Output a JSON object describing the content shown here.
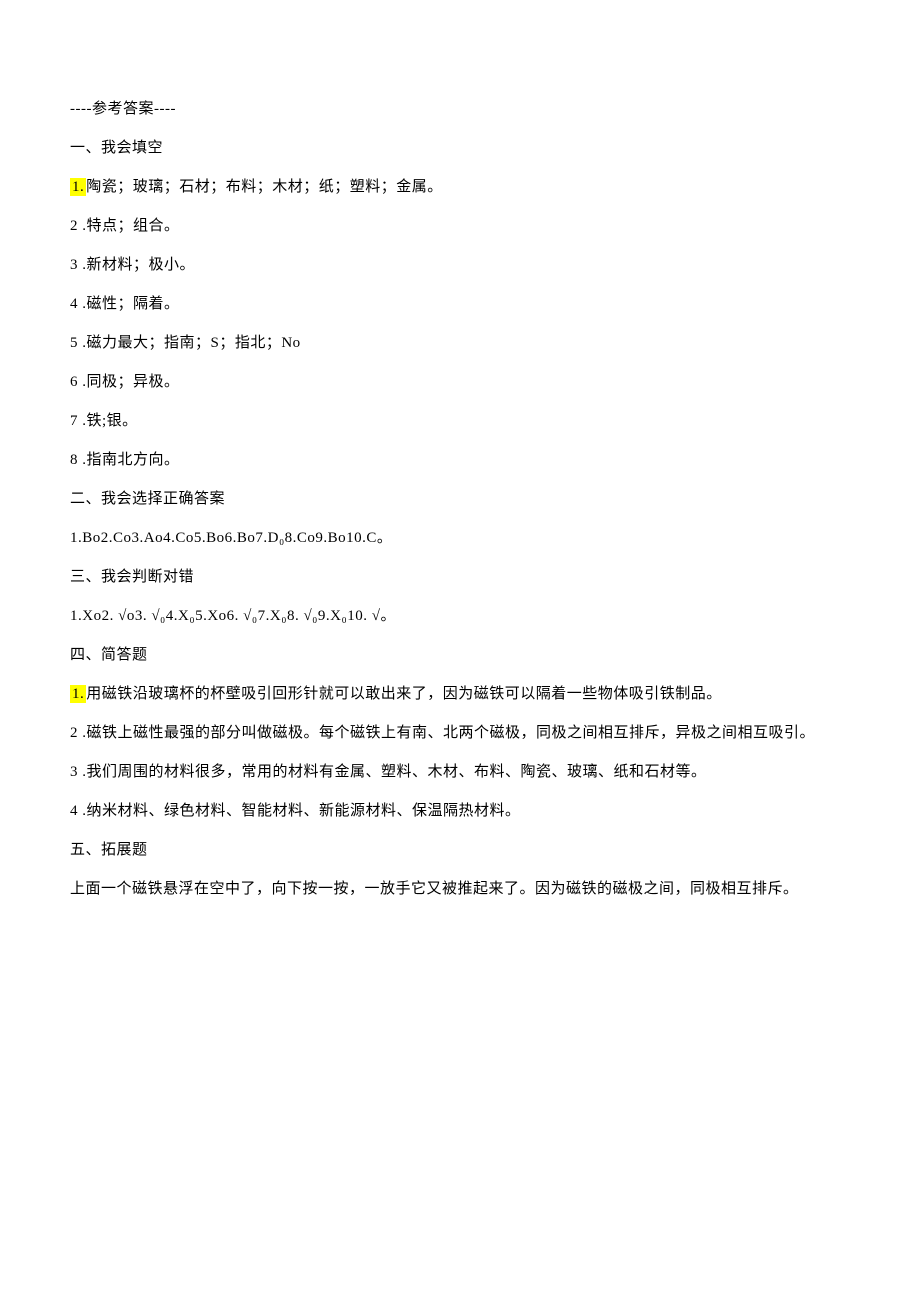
{
  "header": "----参考答案----",
  "section1": {
    "title": "一、我会填空",
    "items": [
      {
        "num": "1.",
        "text": "陶瓷；玻璃；石材；布料；木材；纸；塑料；金属。",
        "highlighted": true
      },
      {
        "num": "2 .",
        "text": "特点；组合。"
      },
      {
        "num": "3 .",
        "text": "新材料；极小。"
      },
      {
        "num": "4 .",
        "text": "磁性；隔着。"
      },
      {
        "num": "5 .",
        "text": "磁力最大；指南；S；指北；No"
      },
      {
        "num": "6 .",
        "text": "同极；异极。"
      },
      {
        "num": "7 .",
        "text": "铁;银。"
      },
      {
        "num": "8 .",
        "text": "指南北方向。"
      }
    ]
  },
  "section2": {
    "title": "二、我会选择正确答案",
    "text": "1.Bo2.Co3.Ao4.Co5.Bo6.Bo7.D₀8.Co9.Bo10.C。"
  },
  "section3": {
    "title": "三、我会判断对错",
    "text": "1.Xo2. √o3. √₀4.X₀5.Xo6. √₀7.X₀8. √₀9.X₀10. √。"
  },
  "section4": {
    "title": "四、简答题",
    "items": [
      {
        "num": "1.",
        "text": "用磁铁沿玻璃杯的杯壁吸引回形针就可以敢出来了，因为磁铁可以隔着一些物体吸引铁制品。",
        "highlighted": true
      },
      {
        "num": "2 .",
        "text": "磁铁上磁性最强的部分叫做磁极。每个磁铁上有南、北两个磁极，同极之间相互排斥，异极之间相互吸引。"
      },
      {
        "num": "3 .",
        "text": "我们周围的材料很多，常用的材料有金属、塑料、木材、布料、陶瓷、玻璃、纸和石材等。"
      },
      {
        "num": "4 .",
        "text": "纳米材料、绿色材料、智能材料、新能源材料、保温隔热材料。"
      }
    ]
  },
  "section5": {
    "title": "五、拓展题",
    "text": "上面一个磁铁悬浮在空中了，向下按一按，一放手它又被推起来了。因为磁铁的磁极之间，同极相互排斥。"
  }
}
